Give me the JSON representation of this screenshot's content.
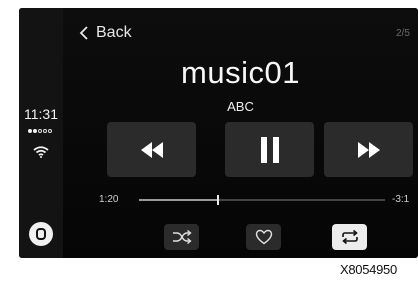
{
  "status": {
    "time": "11:31",
    "signal_bars_on": 2,
    "signal_bars_total": 5,
    "wifi_icon": "wifi-icon"
  },
  "nav": {
    "back_label": "Back",
    "page_indicator": "2/5"
  },
  "track": {
    "title": "music01",
    "artist": "ABC",
    "elapsed": "1:20",
    "remaining": "-3:1",
    "progress_fraction": 0.32
  },
  "controls": {
    "rewind_icon": "rewind-icon",
    "pause_icon": "pause-icon",
    "fast_forward_icon": "fast-forward-icon",
    "shuffle_icon": "shuffle-icon",
    "favorite_icon": "heart-icon",
    "repeat_icon": "repeat-icon",
    "repeat_active": true
  },
  "figure_code": "X8054950",
  "colors": {
    "background": "#000000",
    "button": "#2b2b2b",
    "text": "#f7f7f7",
    "active_toggle": "#ececec"
  }
}
